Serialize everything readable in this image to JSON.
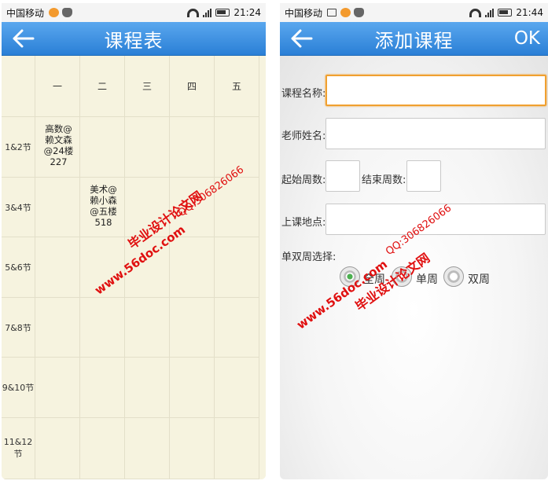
{
  "status_left": {
    "carrier": "中国移动",
    "time": "21:24"
  },
  "status_right": {
    "carrier": "中国移动",
    "time": "21:44"
  },
  "timetable": {
    "title": "课程表",
    "days": [
      "一",
      "二",
      "三",
      "四",
      "五"
    ],
    "periods": [
      "1&2节",
      "3&4节",
      "5&6节",
      "7&8节",
      "9&10节",
      "11&12节"
    ],
    "courses": [
      {
        "text": "高数@赖文森@24楼227"
      },
      {
        "text": "美术@赖小森@五楼518"
      }
    ]
  },
  "add_course": {
    "title": "添加课程",
    "ok_label": "OK",
    "name_label": "课程名称:",
    "teacher_label": "老师姓名:",
    "start_week_label": "起始周数:",
    "end_week_label": "结束周数:",
    "location_label": "上课地点:",
    "week_type_label": "单双周选择:",
    "options": [
      "全周",
      "单周",
      "双周"
    ]
  },
  "watermark": {
    "site": "www.56doc.com",
    "qq": "QQ:306826066",
    "name": "毕业设计论文网"
  },
  "colors": {
    "titlebar": "#2a7fd6",
    "grid_bg": "#f6f3df",
    "focus": "#f0a030",
    "watermark": "#e01010"
  }
}
